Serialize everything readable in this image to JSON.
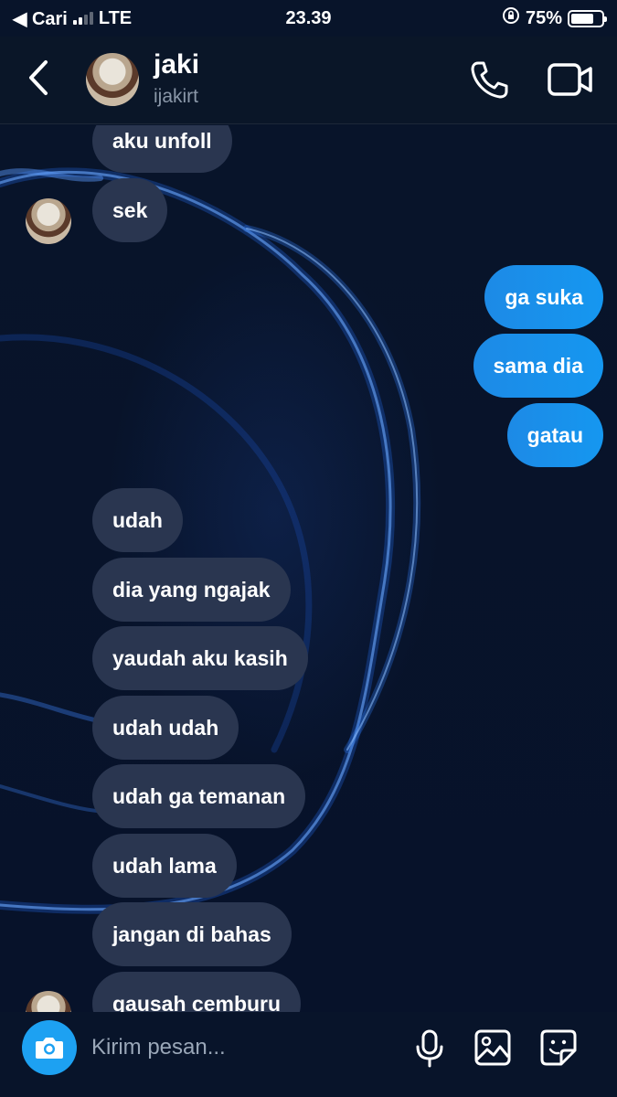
{
  "status_bar": {
    "carrier_back": "◀ Cari",
    "network": "LTE",
    "time": "23.39",
    "battery": "75%",
    "battery_level": 0.75
  },
  "header": {
    "name": "jaki",
    "handle": "ijakirt"
  },
  "messages": [
    {
      "direction": "in",
      "text": "aku unfoll"
    },
    {
      "direction": "in",
      "text": "sek",
      "avatar": true
    },
    {
      "direction": "out",
      "text": "ga suka"
    },
    {
      "direction": "out",
      "text": "sama dia"
    },
    {
      "direction": "out",
      "text": "gatau"
    },
    {
      "direction": "in",
      "text": "udah"
    },
    {
      "direction": "in",
      "text": "dia yang ngajak"
    },
    {
      "direction": "in",
      "text": "yaudah aku kasih"
    },
    {
      "direction": "in",
      "text": "udah udah"
    },
    {
      "direction": "in",
      "text": "udah ga temanan"
    },
    {
      "direction": "in",
      "text": "udah lama"
    },
    {
      "direction": "in",
      "text": "jangan di bahas"
    },
    {
      "direction": "in",
      "text": "gausah cemburu",
      "avatar": true
    }
  ],
  "composer": {
    "placeholder": "Kirim pesan..."
  },
  "colors": {
    "background": "#08142a",
    "incoming_bubble": "#2a3650",
    "outgoing_bubble": "#1d8ae6",
    "accent": "#1da1f2"
  }
}
